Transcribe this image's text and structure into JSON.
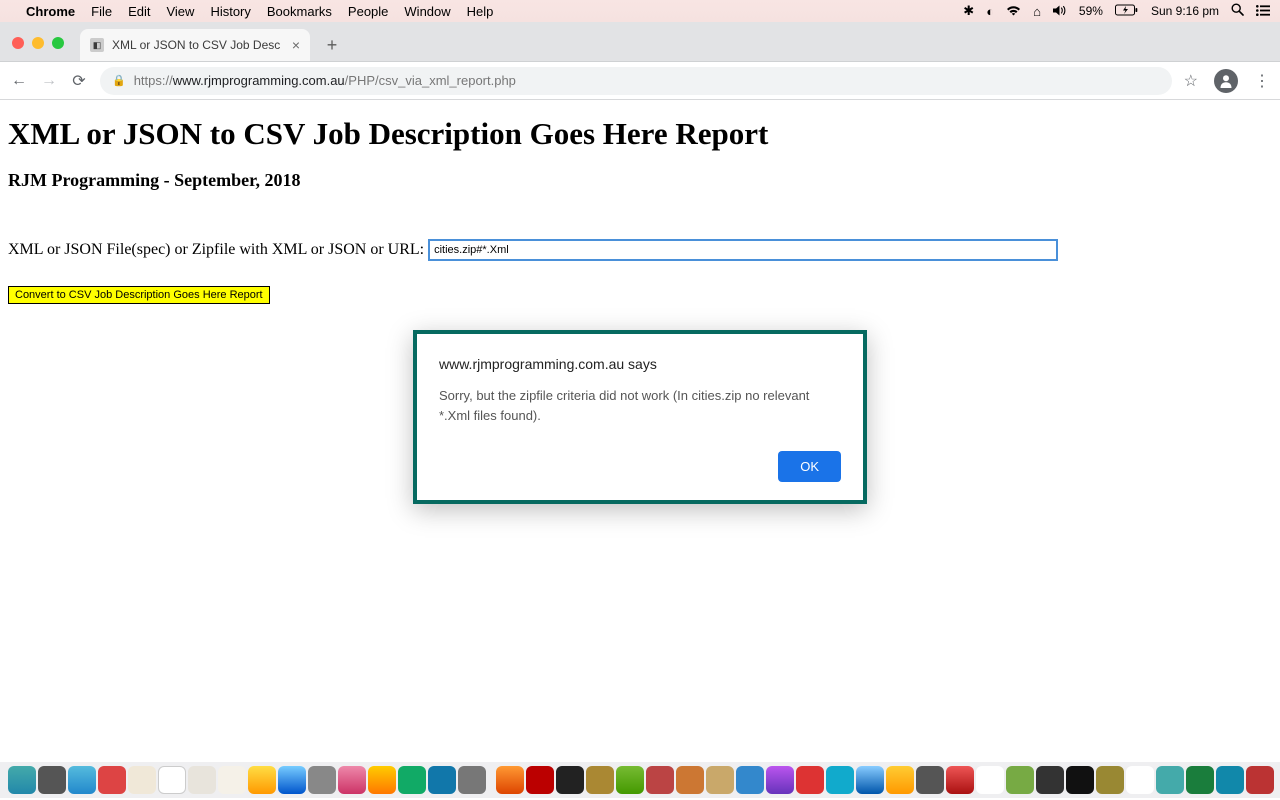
{
  "menubar": {
    "app": "Chrome",
    "items": [
      "File",
      "Edit",
      "View",
      "History",
      "Bookmarks",
      "People",
      "Window",
      "Help"
    ],
    "battery": "59%",
    "clock": "Sun 9:16 pm"
  },
  "tab": {
    "title": "XML or JSON to CSV Job Desc"
  },
  "url": {
    "scheme": "https://",
    "host": "www.rjmprogramming.com.au",
    "path": "/PHP/csv_via_xml_report.php"
  },
  "page": {
    "h1": "XML or JSON to CSV Job Description Goes Here Report",
    "h3": "RJM Programming - September, 2018",
    "label": "XML or JSON File(spec) or Zipfile with XML or JSON or URL:",
    "input_value": "cities.zip#*.Xml",
    "button": "Convert to CSV Job Description Goes Here Report"
  },
  "alert": {
    "title": "www.rjmprogramming.com.au says",
    "body": "Sorry, but the zipfile criteria did not work (In cities.zip no relevant *.Xml files found).",
    "ok": "OK"
  }
}
